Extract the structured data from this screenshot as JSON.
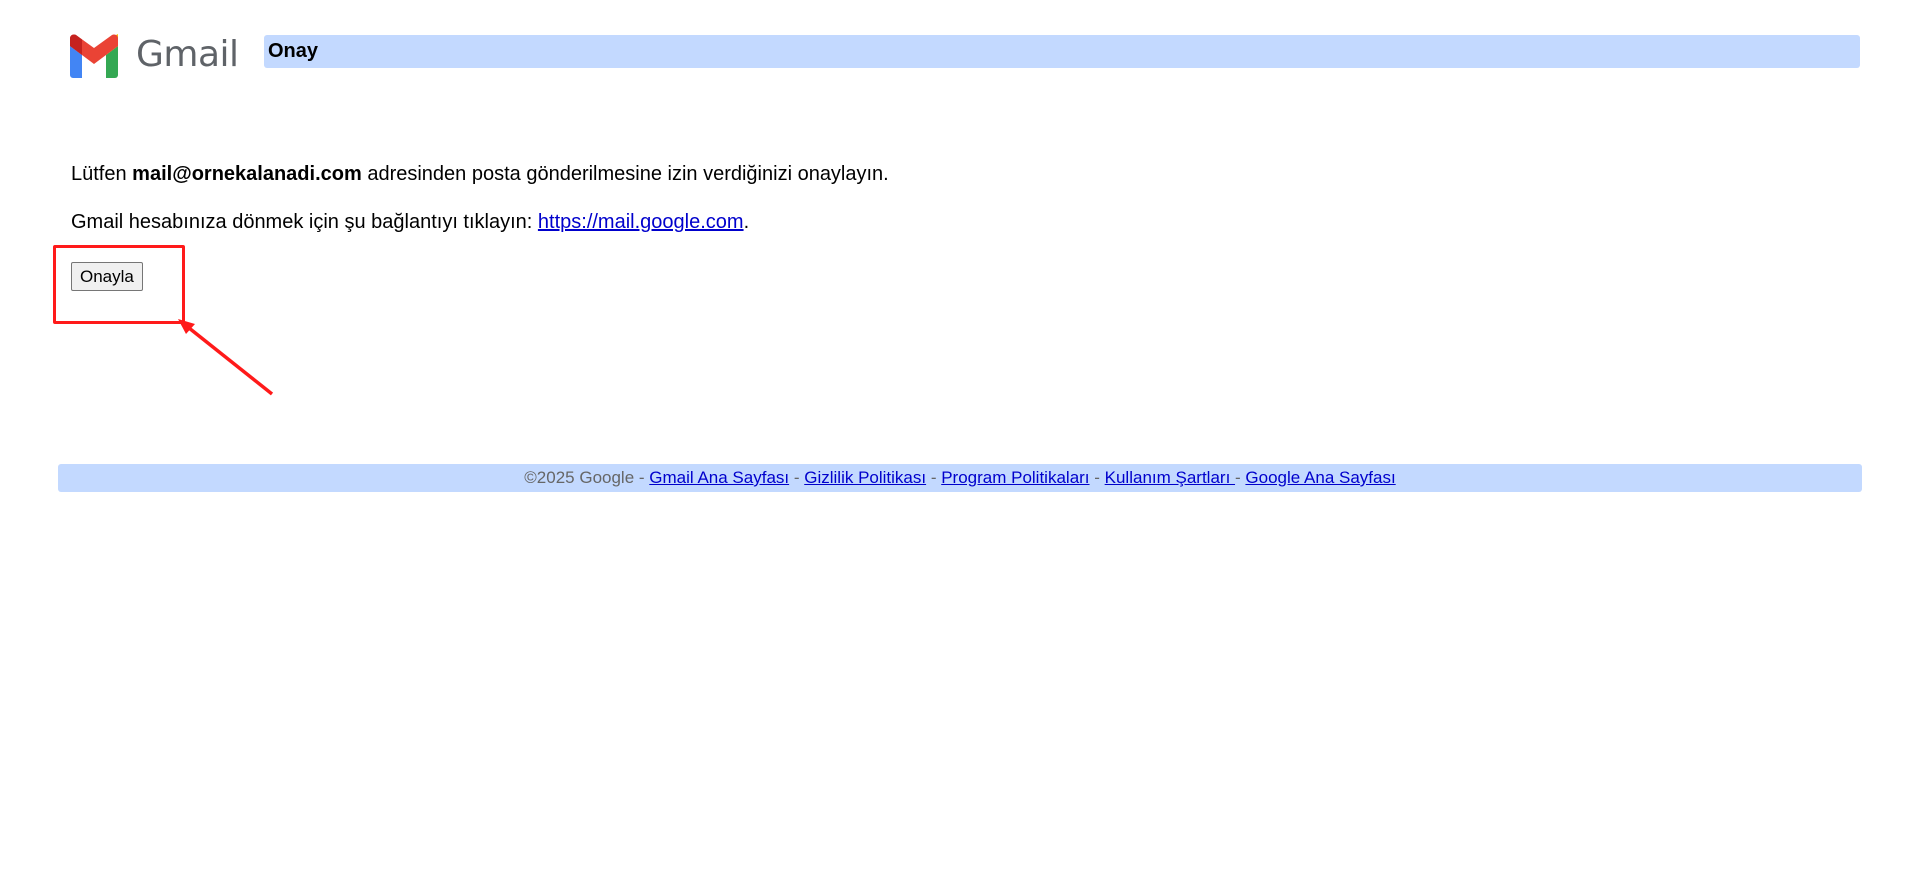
{
  "header": {
    "logo_text": "Gmail",
    "title": "Onay"
  },
  "message": {
    "line1_prefix": "Lütfen ",
    "email": "mail@ornekalanadi.com",
    "line1_suffix": " adresinden posta gönderilmesine izin verdiğinizi onaylayın.",
    "line2_prefix": "Gmail hesabınıza dönmek için şu bağlantıyı tıklayın: ",
    "link_text": "https://mail.google.com",
    "line2_suffix": "."
  },
  "confirm_button": {
    "label": "Onayla"
  },
  "footer": {
    "copyright": "©2025 Google",
    "separator": " - ",
    "links": [
      "Gmail Ana Sayfası",
      "Gizlilik Politikası",
      "Program Politikaları",
      "Kullanım Şartları ",
      "Google Ana Sayfası"
    ]
  },
  "colors": {
    "bar_blue": "#c3d9ff",
    "link_blue": "#0000cc",
    "annotation_red": "#ff1a1a"
  }
}
